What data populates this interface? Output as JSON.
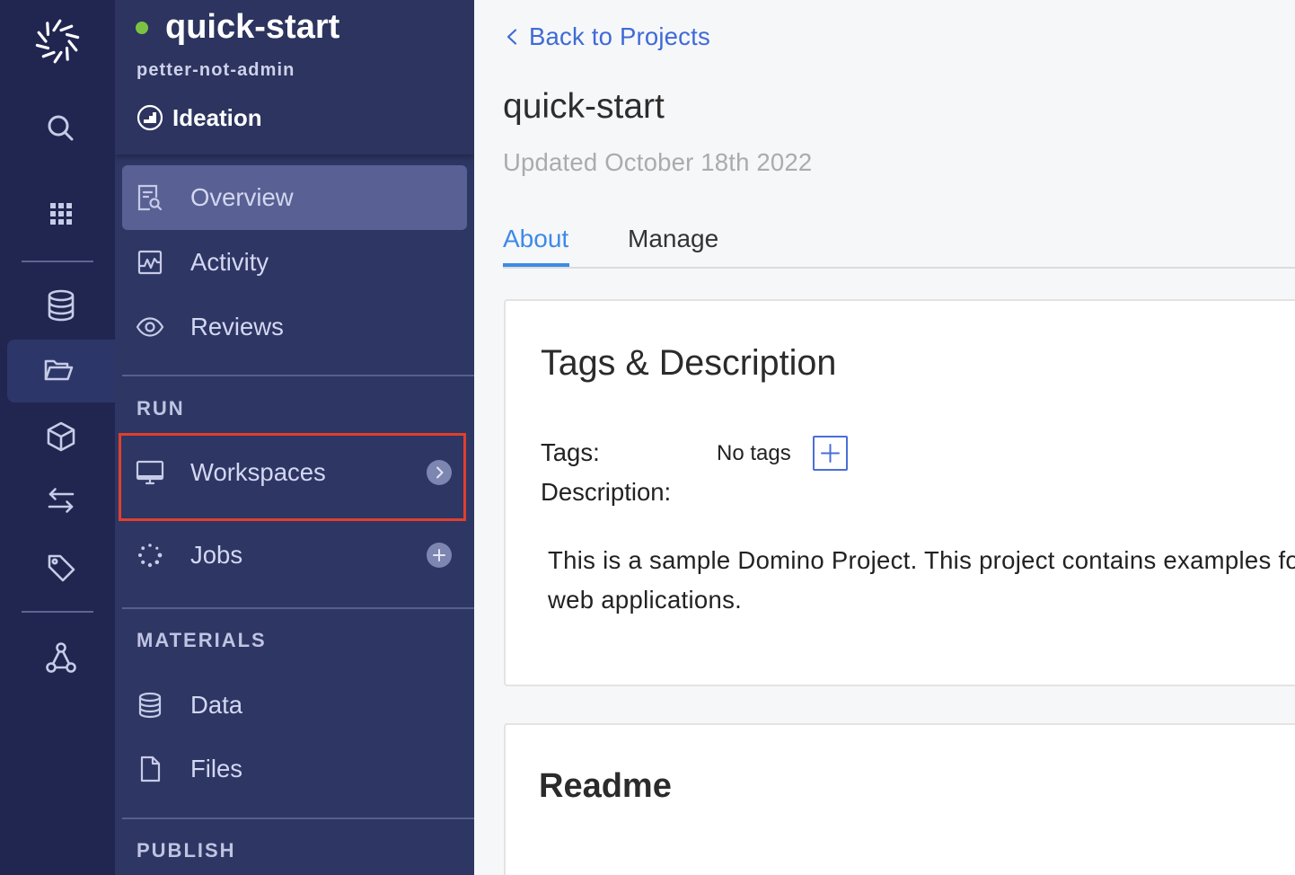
{
  "rail": {
    "logo_icon": "domino-logo-icon",
    "items": [
      {
        "icon": "search-icon"
      },
      {
        "icon": "apps-grid-icon"
      },
      {
        "icon": "database-icon"
      },
      {
        "icon": "folder-open-icon",
        "active": true
      },
      {
        "icon": "cube-icon"
      },
      {
        "icon": "transfer-arrows-icon"
      },
      {
        "icon": "tag-icon"
      },
      {
        "icon": "network-icon"
      }
    ]
  },
  "project": {
    "name": "quick-start",
    "owner": "petter-not-admin",
    "stage": "Ideation",
    "stage_icon": "stage-chart-icon"
  },
  "nav": {
    "main": [
      {
        "label": "Overview",
        "icon": "overview-icon",
        "active": true
      },
      {
        "label": "Activity",
        "icon": "activity-icon"
      },
      {
        "label": "Reviews",
        "icon": "eye-icon"
      }
    ],
    "run": {
      "title": "RUN",
      "items": [
        {
          "label": "Workspaces",
          "icon": "monitor-icon",
          "action_icon": "chevron-right-icon",
          "highlighted": true
        },
        {
          "label": "Jobs",
          "icon": "jobs-spinner-icon",
          "action_icon": "plus-icon"
        }
      ]
    },
    "materials": {
      "title": "MATERIALS",
      "items": [
        {
          "label": "Data",
          "icon": "database-icon"
        },
        {
          "label": "Files",
          "icon": "file-icon"
        }
      ]
    },
    "publish": {
      "title": "PUBLISH"
    }
  },
  "main": {
    "back_link": {
      "label": "Back to Projects",
      "icon": "chevron-left-icon"
    },
    "title": "quick-start",
    "updated": "Updated October 18th 2022",
    "tabs": [
      {
        "label": "About",
        "active": true
      },
      {
        "label": "Manage",
        "active": false
      }
    ],
    "tags_card": {
      "heading": "Tags & Description",
      "tags_label": "Tags:",
      "tags_value": "No tags",
      "add_tag_icon": "plus-icon",
      "description_label": "Description:",
      "description_lines": [
        "This is a sample Domino Project. This project contains examples fo",
        "web applications."
      ]
    },
    "readme_card": {
      "heading": "Readme"
    }
  },
  "colors": {
    "rail_bg": "#202650",
    "sidebar_bg": "#2e3664",
    "nav_active_bg": "#596194",
    "nav_text": "#d3d7f1",
    "status_dot": "#7cc242",
    "link_blue": "#3f6ad8",
    "tab_active": "#3d8ae6",
    "annotation_red": "#e0402c",
    "content_bg": "#f6f7f9"
  }
}
